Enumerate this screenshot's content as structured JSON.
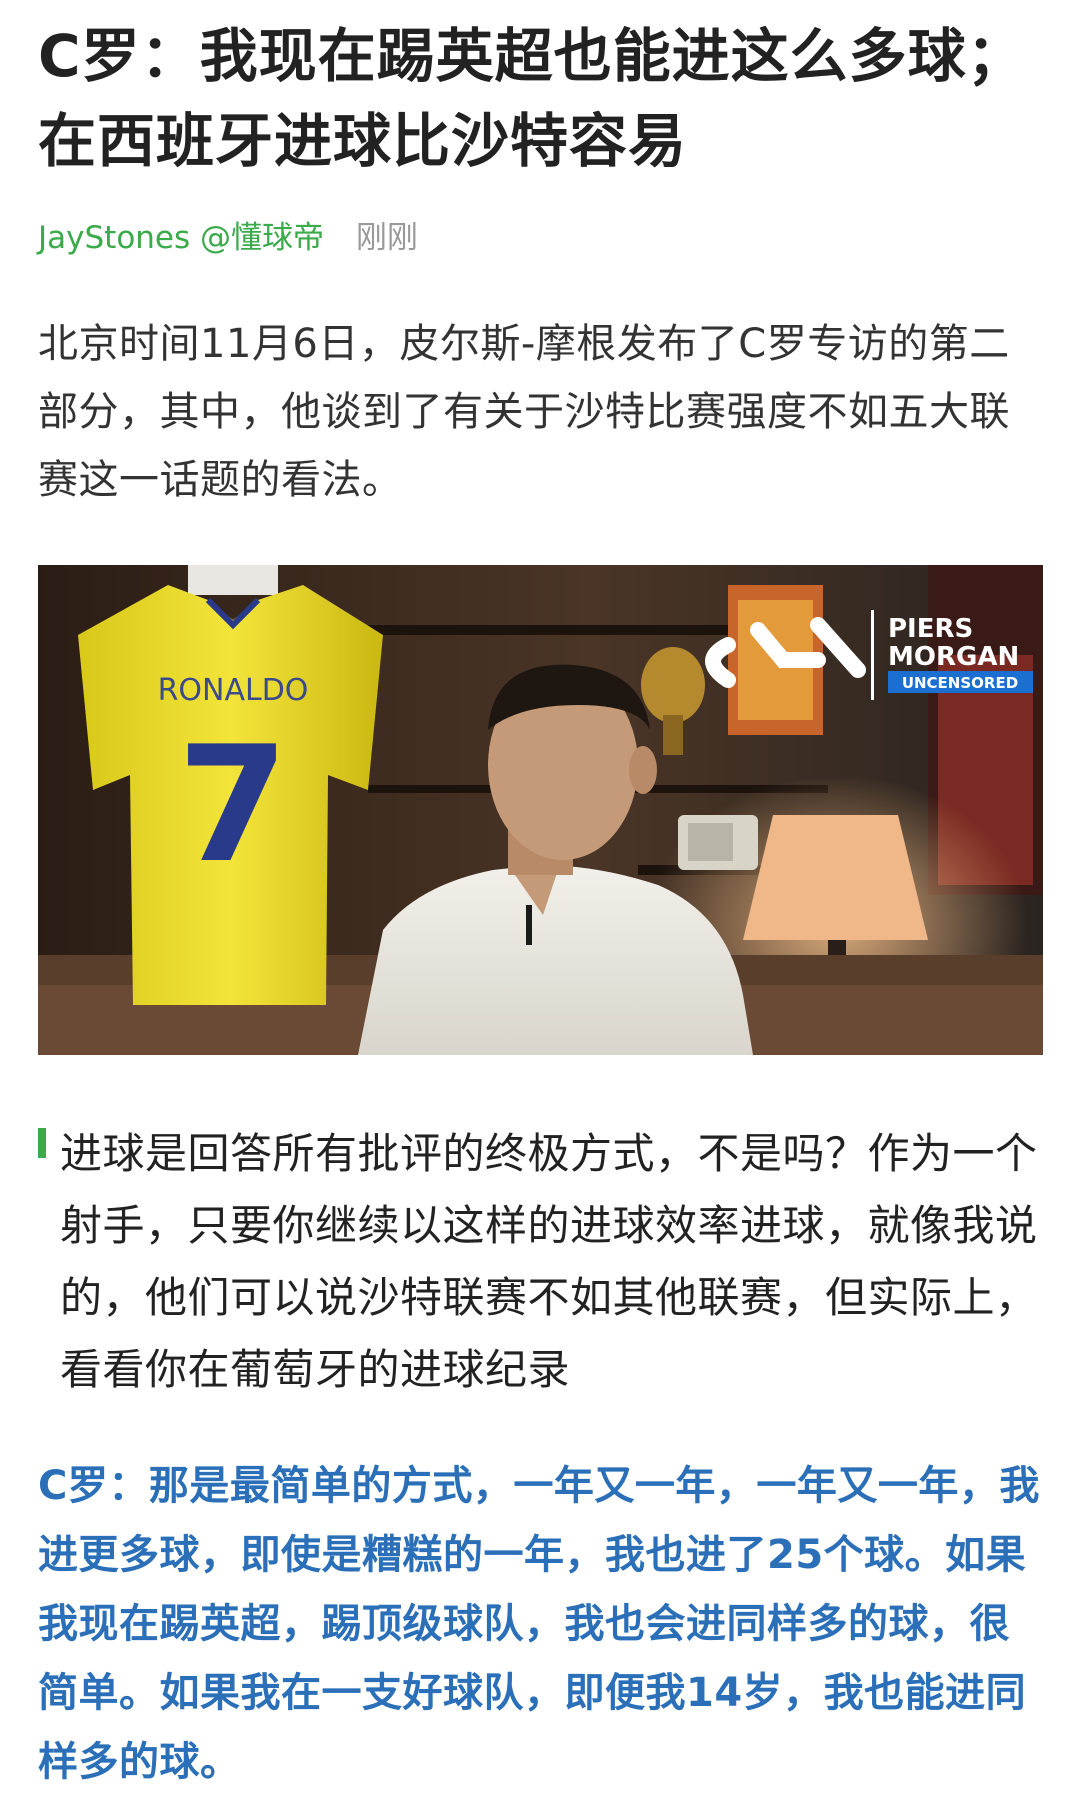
{
  "article": {
    "title": "C罗：我现在踢英超也能进这么多球；在西班牙进球比沙特容易",
    "author": "JayStones @懂球帝",
    "time": "刚刚",
    "intro": "北京时间11月6日，皮尔斯-摩根发布了C罗专访的第二部分，其中，他谈到了有关于沙特比赛强度不如五大联赛这一话题的看法。",
    "image": {
      "jersey_name": "RONALDO",
      "jersey_number": "7",
      "logo_line1": "PIERS",
      "logo_line2": "MORGAN",
      "logo_line3": "UNCENSORED"
    },
    "quote": "进球是回答所有批评的终极方式，不是吗？作为一个射手，只要你继续以这样的进球效率进球，就像我说的，他们可以说沙特联赛不如其他联赛，但实际上，看看你在葡萄牙的进球纪录",
    "answer": "C罗：那是最简单的方式，一年又一年，一年又一年，我进更多球，即使是糟糕的一年，我也进了25个球。如果我现在踢英超，踢顶级球队，我也会进同样多的球，很简单。如果我在一支好球队，即便我14岁，我也能进同样多的球。"
  },
  "colors": {
    "author": "#3aaa4a",
    "quote_bar": "#3aaa4a",
    "answer": "#2a6fb8",
    "time": "#999999"
  }
}
